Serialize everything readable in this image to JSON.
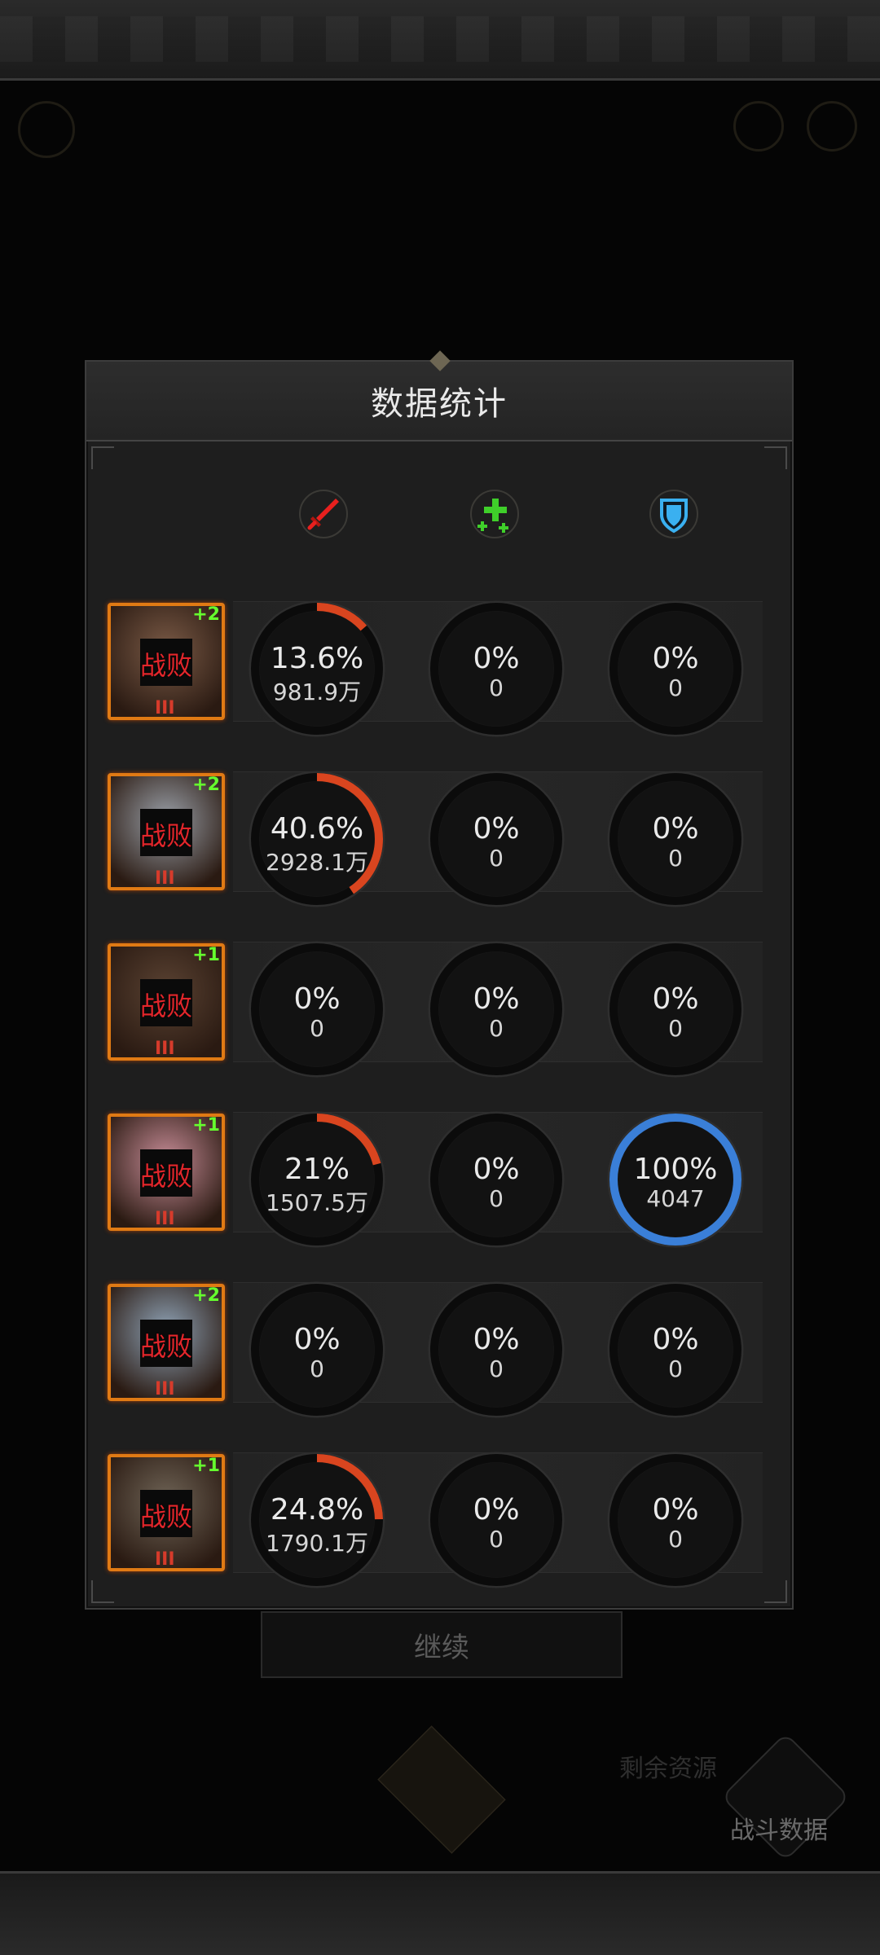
{
  "panel": {
    "title": "数据统计"
  },
  "header_icons": [
    {
      "name": "sword-icon",
      "color": "#e8201e"
    },
    {
      "name": "heal-cross-icon",
      "color": "#3fcf2a"
    },
    {
      "name": "shield-icon",
      "color": "#3ab0f0"
    }
  ],
  "background": {
    "continue_label": "继续",
    "battle_data_label": "战斗数据",
    "remaining_label": "剩余资源"
  },
  "colors": {
    "damage": "#d9451f",
    "heal": "#3fcf2a",
    "tank": "#3a7fd8",
    "defeat": "#e3262b",
    "star": "#66ff2e"
  },
  "heroes": [
    {
      "status": "战败",
      "plus": "+2",
      "tier": "III",
      "portrait": "#7a5a46",
      "damage": {
        "pct_label": "13.6%",
        "val_label": "981.9万",
        "pct": 13.6
      },
      "heal": {
        "pct_label": "0%",
        "val_label": "0",
        "pct": 0
      },
      "tank": {
        "pct_label": "0%",
        "val_label": "0",
        "pct": 0
      }
    },
    {
      "status": "战败",
      "plus": "+2",
      "tier": "III",
      "portrait": "#9aa0a8",
      "damage": {
        "pct_label": "40.6%",
        "val_label": "2928.1万",
        "pct": 40.6
      },
      "heal": {
        "pct_label": "0%",
        "val_label": "0",
        "pct": 0
      },
      "tank": {
        "pct_label": "0%",
        "val_label": "0",
        "pct": 0
      }
    },
    {
      "status": "战败",
      "plus": "+1",
      "tier": "III",
      "portrait": "#5a4232",
      "damage": {
        "pct_label": "0%",
        "val_label": "0",
        "pct": 0
      },
      "heal": {
        "pct_label": "0%",
        "val_label": "0",
        "pct": 0
      },
      "tank": {
        "pct_label": "0%",
        "val_label": "0",
        "pct": 0
      }
    },
    {
      "status": "战败",
      "plus": "+1",
      "tier": "III",
      "portrait": "#c78c97",
      "damage": {
        "pct_label": "21%",
        "val_label": "1507.5万",
        "pct": 21
      },
      "heal": {
        "pct_label": "0%",
        "val_label": "0",
        "pct": 0
      },
      "tank": {
        "pct_label": "100%",
        "val_label": "4047",
        "pct": 100
      }
    },
    {
      "status": "战败",
      "plus": "+2",
      "tier": "III",
      "portrait": "#8fa3b6",
      "damage": {
        "pct_label": "0%",
        "val_label": "0",
        "pct": 0
      },
      "heal": {
        "pct_label": "0%",
        "val_label": "0",
        "pct": 0
      },
      "tank": {
        "pct_label": "0%",
        "val_label": "0",
        "pct": 0
      }
    },
    {
      "status": "战败",
      "plus": "+1",
      "tier": "III",
      "portrait": "#6f6456",
      "damage": {
        "pct_label": "24.8%",
        "val_label": "1790.1万",
        "pct": 24.8
      },
      "heal": {
        "pct_label": "0%",
        "val_label": "0",
        "pct": 0
      },
      "tank": {
        "pct_label": "0%",
        "val_label": "0",
        "pct": 0
      }
    }
  ]
}
